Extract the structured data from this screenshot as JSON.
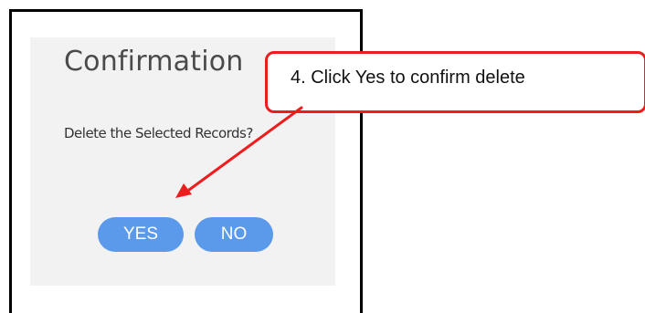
{
  "dialog": {
    "title": "Confirmation",
    "message": "Delete the Selected Records?",
    "yes_label": "YES",
    "no_label": "NO"
  },
  "callout": {
    "text": "4. Click Yes to confirm delete",
    "accent_color": "#ee1c1c"
  },
  "colors": {
    "button": "#5b9aea",
    "dialog_bg": "#f2f2f2"
  }
}
